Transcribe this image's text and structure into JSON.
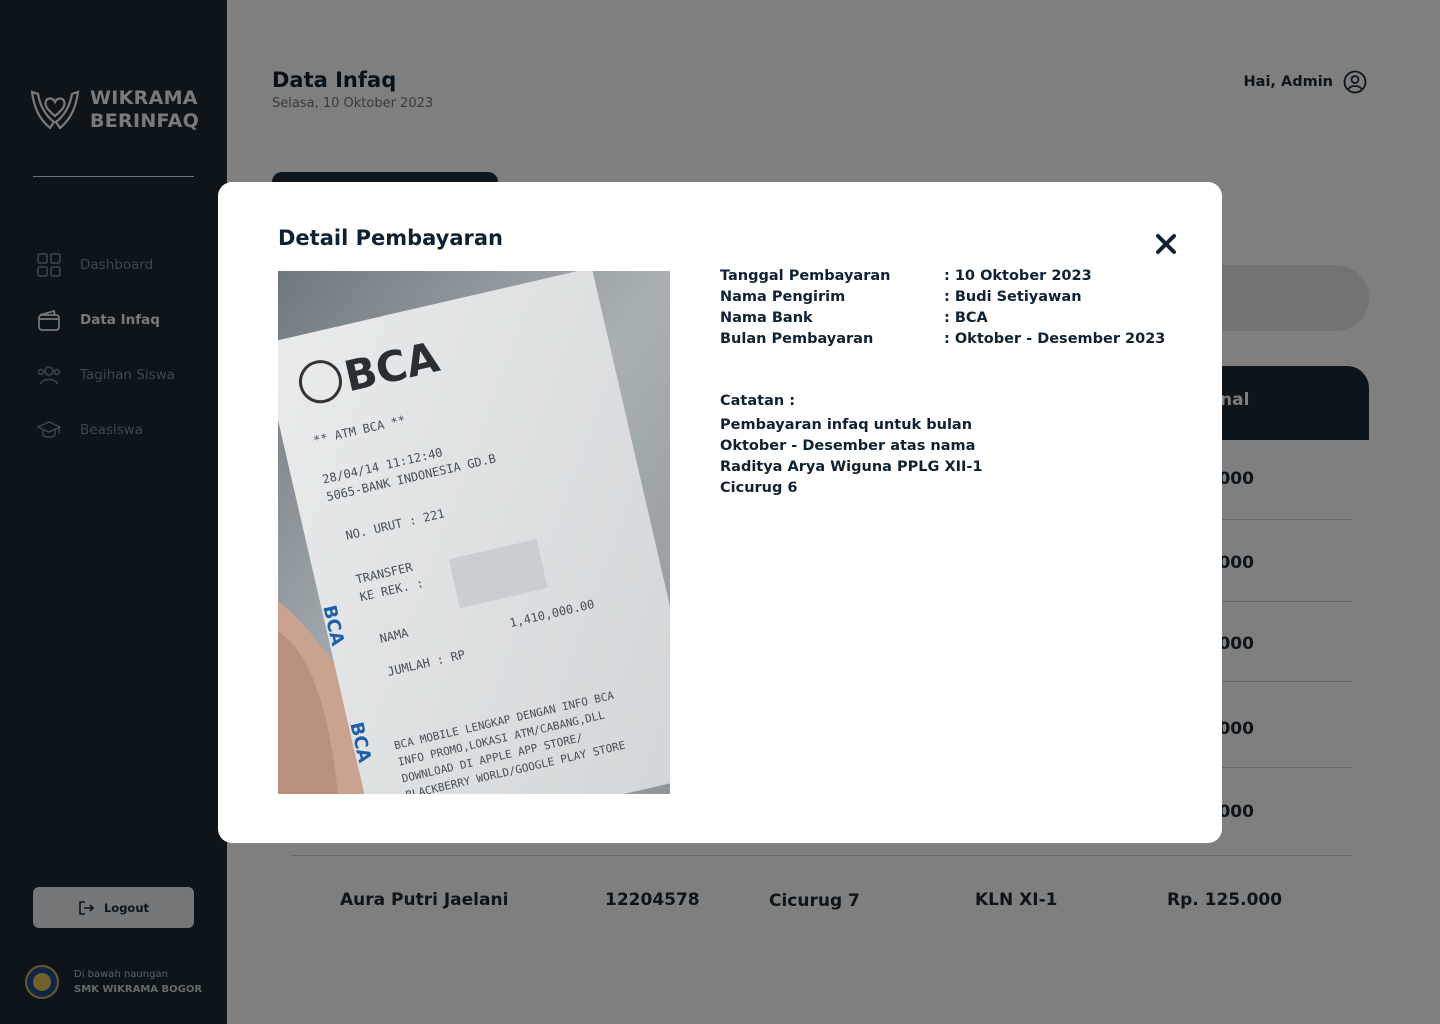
{
  "brand": {
    "line1": "WIKRAMA",
    "line2": "BERINFAQ"
  },
  "sidebar": {
    "items": [
      {
        "label": "Dashboard",
        "icon": "grid-icon"
      },
      {
        "label": "Data Infaq",
        "icon": "wallet-icon",
        "active": true
      },
      {
        "label": "Tagihan Siswa",
        "icon": "users-icon"
      },
      {
        "label": "Beasiswa",
        "icon": "graduation-cap-icon"
      }
    ],
    "logout_label": "Logout",
    "footer_sub": "Di bawah naungan",
    "footer_name": "SMK WIKRAMA BOGOR"
  },
  "header": {
    "title": "Data Infaq",
    "date": "Selasa, 10 Oktober 2023",
    "greeting": "Hai, Admin"
  },
  "table": {
    "partial_header": "nal",
    "partial_amounts": [
      ".000",
      ".000",
      ".000",
      ".000",
      ".000"
    ],
    "last_row": {
      "name": "Aura Putri Jaelani",
      "nis": "12204578",
      "rayon": "Cicurug 7",
      "rombel": "KLN XI-1",
      "amount": "Rp. 125.000"
    }
  },
  "modal": {
    "title": "Detail Pembayaran",
    "fields": [
      {
        "label": "Tanggal Pembayaran",
        "value": ":  10 Oktober 2023"
      },
      {
        "label": "Nama Pengirim",
        "value": ": Budi Setiyawan"
      },
      {
        "label": "Nama Bank",
        "value": ": BCA"
      },
      {
        "label": "Bulan Pembayaran",
        "value": ": Oktober - Desember 2023"
      }
    ],
    "note_label": "Catatan :",
    "note_text": "Pembayaran infaq untuk bulan Oktober - Desember atas nama Raditya Arya Wiguna PPLG XII-1 Cicurug 6",
    "receipt": {
      "bank": "BCA",
      "lines": [
        "**   ATM BCA   **",
        "28/04/14    11:12:40",
        "5065-BANK INDONESIA GD.B",
        "NO. URUT : 221",
        "TRANSFER",
        "KE REK.  :",
        "NAMA",
        "JUMLAH  : RP",
        "1,410,000.00",
        "BCA MOBILE LENGKAP DENGAN INFO BCA",
        "INFO PROMO,LOKASI ATM/CABANG,DLL",
        "DOWNLOAD DI APPLE APP STORE/",
        "BLACKBERRY WORLD/GOOGLE PLAY STORE"
      ]
    }
  },
  "colors": {
    "sidebar": "#1b2a36",
    "accent": "#0f2233",
    "overlay": "rgba(0,0,0,0.5)"
  }
}
